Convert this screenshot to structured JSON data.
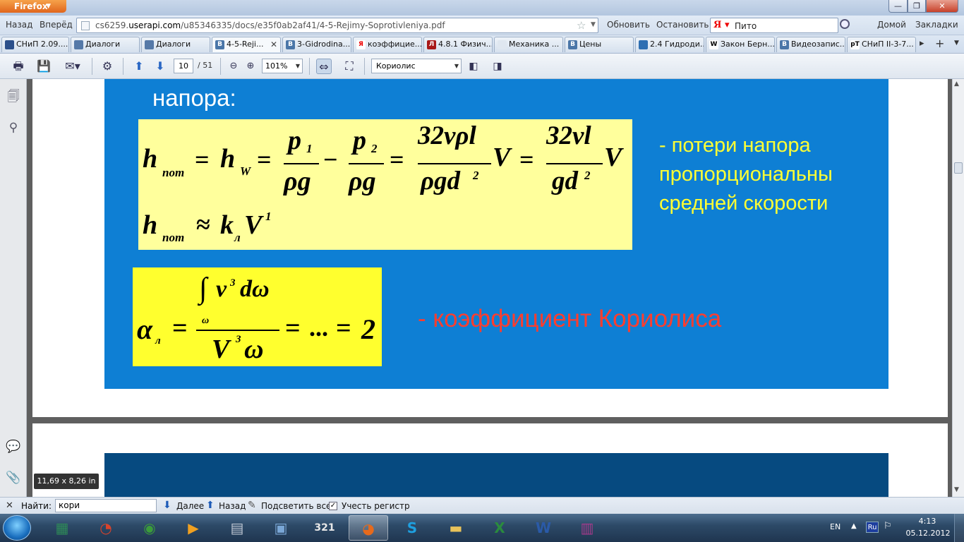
{
  "browser": {
    "menu_button": "Firefox",
    "back": "Назад",
    "forward": "Вперёд",
    "url_dim": "cs6259.",
    "url_host": "userapi.com",
    "url_rest": "/u85346335/docs/e35f0ab2af41/4-5-Rejimy-Soprotivleniya.pdf",
    "refresh": "Обновить",
    "stop": "Остановить",
    "search_value": "Пито",
    "home": "Домой",
    "bookmarks": "Закладки"
  },
  "tabs": [
    {
      "label": "СНиП 2.09....",
      "fav": "#2b4f8a",
      "glyph": ""
    },
    {
      "label": "Диалоги",
      "fav": "#5579a8",
      "glyph": ""
    },
    {
      "label": "Диалоги",
      "fav": "#5579a8",
      "glyph": ""
    },
    {
      "label": "4-5-Reji...",
      "fav": "#4a76a8",
      "glyph": "B",
      "active": true
    },
    {
      "label": "3-Gidrodina...",
      "fav": "#4a76a8",
      "glyph": "B"
    },
    {
      "label": "коэффицие...",
      "fav": "#ffffff",
      "glyph": "Я"
    },
    {
      "label": "4.8.1 Физич...",
      "fav": "#a81818",
      "glyph": "Л"
    },
    {
      "label": "Механика ...",
      "fav": "#dfe7f0",
      "glyph": ""
    },
    {
      "label": "Цены",
      "fav": "#4a76a8",
      "glyph": "B"
    },
    {
      "label": "2.4 Гидроди...",
      "fav": "#2f6fb2",
      "glyph": ""
    },
    {
      "label": "Закон Берн...",
      "fav": "#ffffff",
      "glyph": "W"
    },
    {
      "label": "Видеозапис...",
      "fav": "#4a76a8",
      "glyph": "B"
    },
    {
      "label": "СНиП II-3-7...",
      "fav": "#ffffff",
      "glyph": "pT"
    }
  ],
  "pdf_toolbar": {
    "page": "10",
    "total": "/ 51",
    "zoom": "101%",
    "find_text": "Кориолис"
  },
  "slide": {
    "heading": "напора:",
    "note1": [
      "- потери напора",
      "пропорциональны",
      "средней скорости"
    ],
    "note2": "- коэффициент Кориолиса",
    "f": {
      "h": "h",
      "pot": "пот",
      "eq": "=",
      "W": "W",
      "minus": "−",
      "p1": "p",
      "s1": "1",
      "p2": "p",
      "s2": "2",
      "rho_g": "ρg",
      "n1": "32νρl",
      "d1": "ρgd",
      "sq": "2",
      "V": "V",
      "n2": "32νl",
      "d2": "gd",
      "approx": "≈",
      "k": "k",
      "l": "л",
      "one": "1",
      "alpha": "α",
      "int": "∫",
      "v": "v",
      "three": "3",
      "domega": "dω",
      "omega": "ω",
      "dots": "...",
      "two": "2"
    }
  },
  "size_tip": "11,69 x 8,26 in",
  "findbar": {
    "label": "Найти:",
    "value": "кори",
    "next": "Далее",
    "prev": "Назад",
    "highlight": "Подсветить все",
    "matchcase": "Учесть регистр"
  },
  "taskbar": {
    "apps": [
      {
        "icon": "task-manager-icon",
        "glyph": "▦",
        "color": "#2e8b57"
      },
      {
        "icon": "cccleaner-icon",
        "glyph": "◔",
        "color": "#d9432b"
      },
      {
        "icon": "chrome-icon",
        "glyph": "◉",
        "color": "#3b9b3b"
      },
      {
        "icon": "media-player-icon",
        "glyph": "▶",
        "color": "#f0a020"
      },
      {
        "icon": "calculator-icon",
        "glyph": "▤",
        "color": "#c0c8d4"
      },
      {
        "icon": "kmplayer-icon",
        "glyph": "▣",
        "color": "#7aa7d6"
      },
      {
        "icon": "media-classic-icon",
        "glyph": "321",
        "color": "#e8e8e8"
      },
      {
        "icon": "firefox-icon",
        "glyph": "◕",
        "color": "#e66a1c",
        "active": true
      },
      {
        "icon": "skype-icon",
        "glyph": "S",
        "color": "#1ea0e0"
      },
      {
        "icon": "explorer-icon",
        "glyph": "▬",
        "color": "#e9c35a"
      },
      {
        "icon": "excel-icon",
        "glyph": "X",
        "color": "#2a8b3e"
      },
      {
        "icon": "word-icon",
        "glyph": "W",
        "color": "#2a5aa8"
      },
      {
        "icon": "winrar-icon",
        "glyph": "▥",
        "color": "#a83a8c"
      }
    ],
    "lang": "EN",
    "ime": "Ru",
    "time": "4:13",
    "date": "05.12.2012"
  },
  "colors": {
    "slide_bg": "#0e7fd4",
    "formula_box": "#ffff9c",
    "alpha_box": "#ffff2e",
    "note1": "#ffff33",
    "note2": "#ff3d2e"
  }
}
